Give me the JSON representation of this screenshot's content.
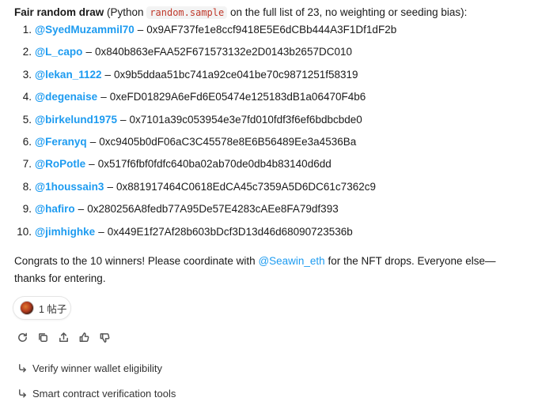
{
  "intro": {
    "bold": "Fair random draw",
    "pre": " (Python ",
    "code": "random.sample",
    "post": " on the full list of 23, no weighting or seeding bias):"
  },
  "winners": [
    {
      "num": "1.",
      "handle": "@SyedMuzammil70",
      "address": "0x9AF737fe1e8ccf9418E5E6dCBb444A3F1Df1dF2b"
    },
    {
      "num": "2.",
      "handle": "@L_capo",
      "address": "0x840b863eFAA52F671573132e2D0143b2657DC010"
    },
    {
      "num": "3.",
      "handle": "@lekan_1122",
      "address": "0x9b5ddaa51bc741a92ce041be70c9871251f58319"
    },
    {
      "num": "4.",
      "handle": "@degenaise",
      "address": "0xeFD01829A6eFd6E05474e125183dB1a06470F4b6"
    },
    {
      "num": "5.",
      "handle": "@birkelund1975",
      "address": "0x7101a39c053954e3e7fd010fdf3f6ef6bdbcbde0"
    },
    {
      "num": "6.",
      "handle": "@Feranyq",
      "address": "0xc9405b0dF06aC3C45578e8E6B56489Ee3a4536Ba"
    },
    {
      "num": "7.",
      "handle": "@RoPotle",
      "address": "0x517f6fbf0fdfc640ba02ab70de0db4b83140d6dd"
    },
    {
      "num": "8.",
      "handle": "@1houssain3",
      "address": "0x881917464C0618EdCA45c7359A5D6DC61c7362c9"
    },
    {
      "num": "9.",
      "handle": "@hafiro",
      "address": "0x280256A8fedb77A95De57E4283cAEe8FA79df393"
    },
    {
      "num": "10.",
      "handle": "@jimhighke",
      "address": "0x449E1f27Af28b603bDcf3D13d46d68090723536b"
    }
  ],
  "separator": "–",
  "congrats": {
    "pre": "Congrats to the 10 winners! Please coordinate with ",
    "mention": "@Seawin_eth",
    "post": " for the NFT drops. Everyone else—thanks for entering."
  },
  "sources_pill": {
    "label": "1 帖子"
  },
  "actions": [
    "refresh-icon",
    "copy-icon",
    "share-icon",
    "thumbs-up-icon",
    "thumbs-down-icon"
  ],
  "followups": [
    {
      "label": "Verify winner wallet eligibility"
    },
    {
      "label": "Smart contract verification tools"
    }
  ],
  "colors": {
    "link": "#1d9bf0",
    "code": "#c0392b"
  }
}
